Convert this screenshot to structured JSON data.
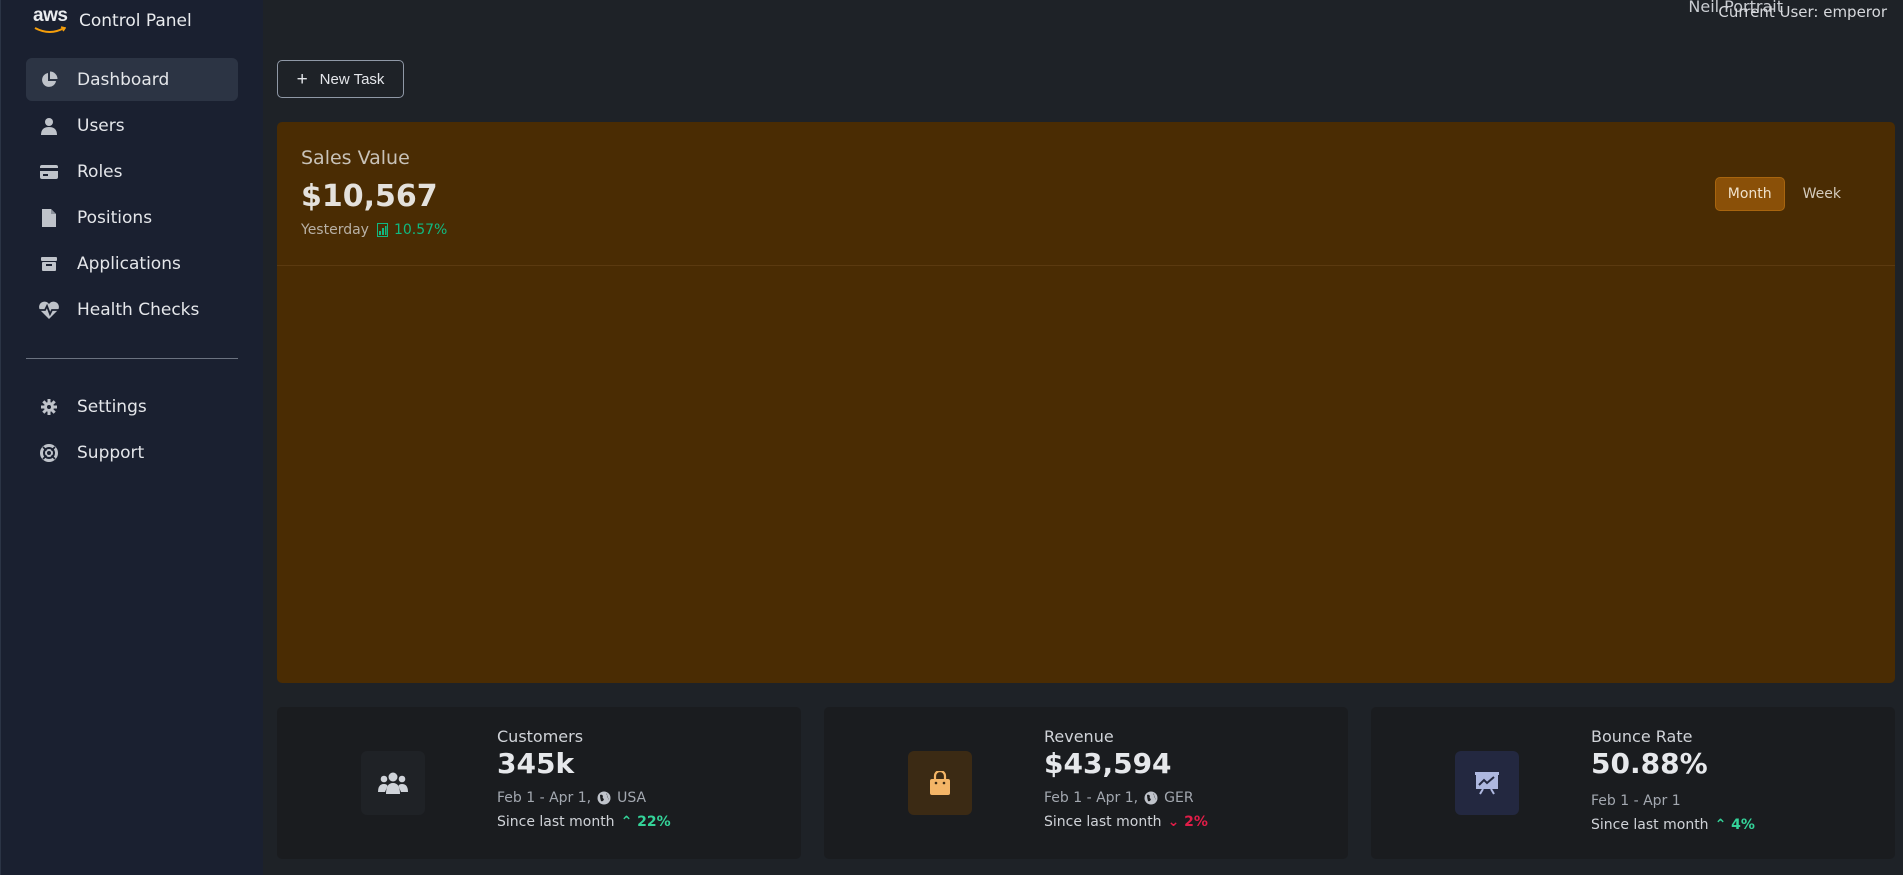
{
  "brand": {
    "logo_text": "aws",
    "title": "Control Panel"
  },
  "sidebar": {
    "items": [
      {
        "label": "Dashboard",
        "icon": "pie-chart-icon",
        "active": true
      },
      {
        "label": "Users",
        "icon": "user-icon"
      },
      {
        "label": "Roles",
        "icon": "credit-card-icon"
      },
      {
        "label": "Positions",
        "icon": "document-icon"
      },
      {
        "label": "Applications",
        "icon": "archive-icon"
      },
      {
        "label": "Health Checks",
        "icon": "heart-pulse-icon"
      }
    ],
    "secondary": [
      {
        "label": "Settings",
        "icon": "gear-icon"
      },
      {
        "label": "Support",
        "icon": "lifebuoy-icon"
      }
    ]
  },
  "topbar": {
    "user_label": "Current User: emperor",
    "overlap_text": "Neil Portrait"
  },
  "toolbar": {
    "new_task_label": "New Task"
  },
  "sales": {
    "title": "Sales Value",
    "value": "$10,567",
    "period_label": "Yesterday",
    "change": "10.57%",
    "toggle": {
      "month": "Month",
      "week": "Week",
      "selected": "Month"
    }
  },
  "stats": [
    {
      "label": "Customers",
      "value": "345k",
      "range": "Feb 1 - Apr 1,",
      "region": "USA",
      "since": "Since last month",
      "change": "22%",
      "direction": "up",
      "icon": "users-icon"
    },
    {
      "label": "Revenue",
      "value": "$43,594",
      "range": "Feb 1 - Apr 1,",
      "region": "GER",
      "since": "Since last month",
      "change": "2%",
      "direction": "down",
      "icon": "shopping-bag-icon"
    },
    {
      "label": "Bounce Rate",
      "value": "50.88%",
      "range": "Feb 1 - Apr 1",
      "region": "",
      "since": "Since last month",
      "change": "4%",
      "direction": "up",
      "icon": "presentation-chart-icon"
    }
  ],
  "colors": {
    "sales_card_bg": "#4a2c03",
    "accent_up": "#34d399",
    "accent_down": "#e11d48",
    "sidebar_bg": "#1a2030"
  }
}
